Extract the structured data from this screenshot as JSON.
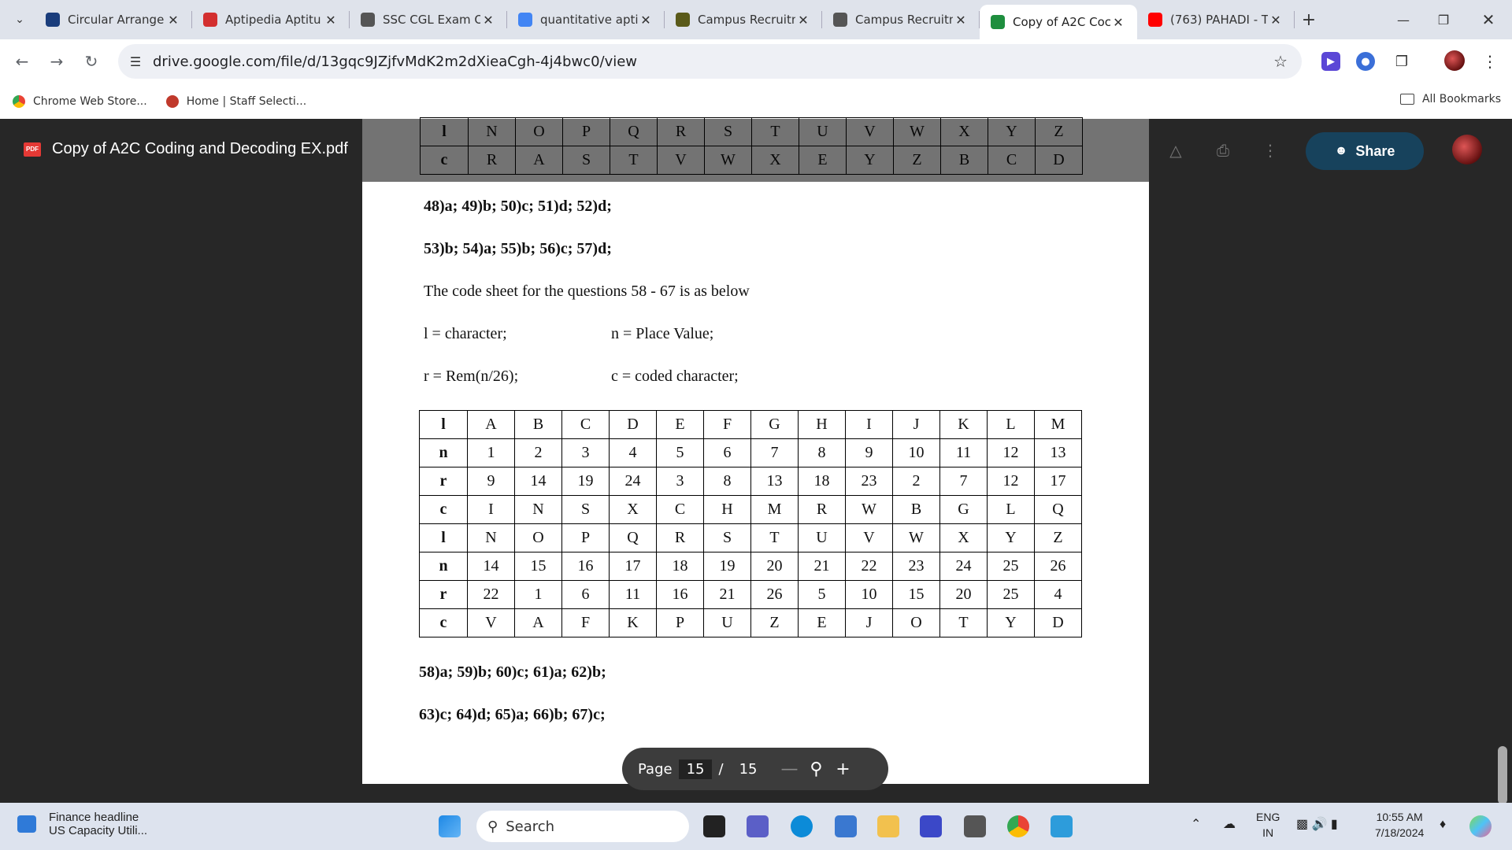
{
  "browser": {
    "tabs": [
      {
        "title": "Circular Arrange",
        "favicon_color": "#1a3d7c",
        "active": false
      },
      {
        "title": "Aptipedia Aptitu",
        "favicon_color": "#d32f2f",
        "active": false
      },
      {
        "title": "SSC CGL Exam O",
        "favicon_color": "#555555",
        "active": false
      },
      {
        "title": "quantitative apti",
        "favicon_color": "#4285f4",
        "active": false
      },
      {
        "title": "Campus Recruitm",
        "favicon_color": "#5a5a1a",
        "active": false
      },
      {
        "title": "Campus Recruitm",
        "favicon_color": "#555555",
        "active": false
      },
      {
        "title": "Copy of A2C Coc",
        "favicon_color": "#1e8e3e",
        "active": true
      },
      {
        "title": "(763) PAHADI - T",
        "favicon_color": "#ff0000",
        "active": false
      }
    ],
    "close_glyph": "✕",
    "new_tab_glyph": "+",
    "url": "drive.google.com/file/d/13gqc9JZjfvMdK2m2dXieaCgh-4j4bwc0/view",
    "bookmarks": [
      {
        "label": "Chrome Web Store..."
      },
      {
        "label": "Home | Staff Selecti..."
      }
    ],
    "all_bookmarks": "All Bookmarks"
  },
  "viewer": {
    "file_title": "Copy of A2C Coding and Decoding EX.pdf",
    "pdf_badge": "PDF",
    "share_label": "Share",
    "page_label": "Page",
    "current_page": "15",
    "page_sep": "/",
    "total_pages": "15"
  },
  "document": {
    "answers_line1": "48)a;   49)b;   50)c;   51)d;   52)d;",
    "answers_line2": "53)b;   54)a;   55)b;   56)c;   57)d;",
    "intro": "The code sheet for the questions 58 - 67 is as below",
    "def_l": "l = character;",
    "def_n": "n = Place Value;",
    "def_r": "r = Rem(n/26);",
    "def_c": "c = coded character;",
    "answers_line3": "58)a;   59)b;   60)c;   61)a;   62)b;",
    "answers_line4": "63)c;   64)d;   65)a;   66)b;   67)c;",
    "top_partial_rows": [
      [
        "l",
        "N",
        "O",
        "P",
        "Q",
        "R",
        "S",
        "T",
        "U",
        "V",
        "W",
        "X",
        "Y",
        "Z"
      ],
      [
        "c",
        "R",
        "A",
        "S",
        "T",
        "V",
        "W",
        "X",
        "E",
        "Y",
        "Z",
        "B",
        "C",
        "D"
      ]
    ],
    "code_table": [
      [
        "l",
        "A",
        "B",
        "C",
        "D",
        "E",
        "F",
        "G",
        "H",
        "I",
        "J",
        "K",
        "L",
        "M"
      ],
      [
        "n",
        "1",
        "2",
        "3",
        "4",
        "5",
        "6",
        "7",
        "8",
        "9",
        "10",
        "11",
        "12",
        "13"
      ],
      [
        "r",
        "9",
        "14",
        "19",
        "24",
        "3",
        "8",
        "13",
        "18",
        "23",
        "2",
        "7",
        "12",
        "17"
      ],
      [
        "c",
        "I",
        "N",
        "S",
        "X",
        "C",
        "H",
        "M",
        "R",
        "W",
        "B",
        "G",
        "L",
        "Q"
      ],
      [
        "l",
        "N",
        "O",
        "P",
        "Q",
        "R",
        "S",
        "T",
        "U",
        "V",
        "W",
        "X",
        "Y",
        "Z"
      ],
      [
        "n",
        "14",
        "15",
        "16",
        "17",
        "18",
        "19",
        "20",
        "21",
        "22",
        "23",
        "24",
        "25",
        "26"
      ],
      [
        "r",
        "22",
        "1",
        "6",
        "11",
        "16",
        "21",
        "26",
        "5",
        "10",
        "15",
        "20",
        "25",
        "4"
      ],
      [
        "c",
        "V",
        "A",
        "F",
        "K",
        "P",
        "U",
        "Z",
        "E",
        "J",
        "O",
        "T",
        "Y",
        "D"
      ]
    ]
  },
  "taskbar": {
    "news_title": "Finance headline",
    "news_sub": "US Capacity Utili...",
    "search_label": "Search",
    "lang_top": "ENG",
    "lang_bottom": "IN",
    "time": "10:55 AM",
    "date": "7/18/2024"
  }
}
